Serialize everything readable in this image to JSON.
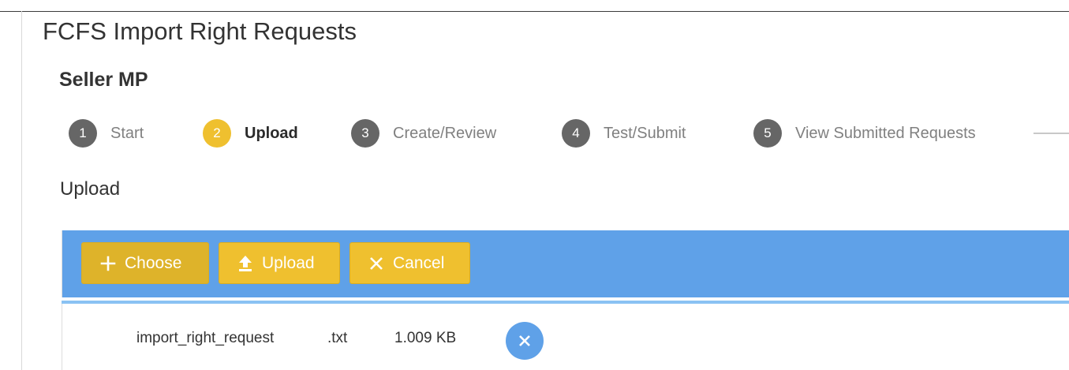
{
  "page": {
    "title": "FCFS Import Right Requests",
    "section_title": "Seller MP",
    "subsection_title": "Upload"
  },
  "steps": [
    {
      "number": "1",
      "label": "Start",
      "active": false
    },
    {
      "number": "2",
      "label": "Upload",
      "active": true
    },
    {
      "number": "3",
      "label": "Create/Review",
      "active": false
    },
    {
      "number": "4",
      "label": "Test/Submit",
      "active": false
    },
    {
      "number": "5",
      "label": "View Submitted Requests",
      "active": false
    }
  ],
  "uploader": {
    "buttons": {
      "choose": {
        "label": "Choose",
        "icon": "plus-icon"
      },
      "upload": {
        "label": "Upload",
        "icon": "upload-icon"
      },
      "cancel": {
        "label": "Cancel",
        "icon": "close-icon"
      }
    },
    "file": {
      "name": "import_right_request",
      "extension": ".txt",
      "size": "1.009 KB",
      "remove_icon": "close-icon"
    }
  },
  "colors": {
    "accent_yellow": "#efc02f",
    "step_inactive": "#666666",
    "uploader_header_blue": "#5fa1e8",
    "remove_button_blue": "#5fa1e8"
  }
}
